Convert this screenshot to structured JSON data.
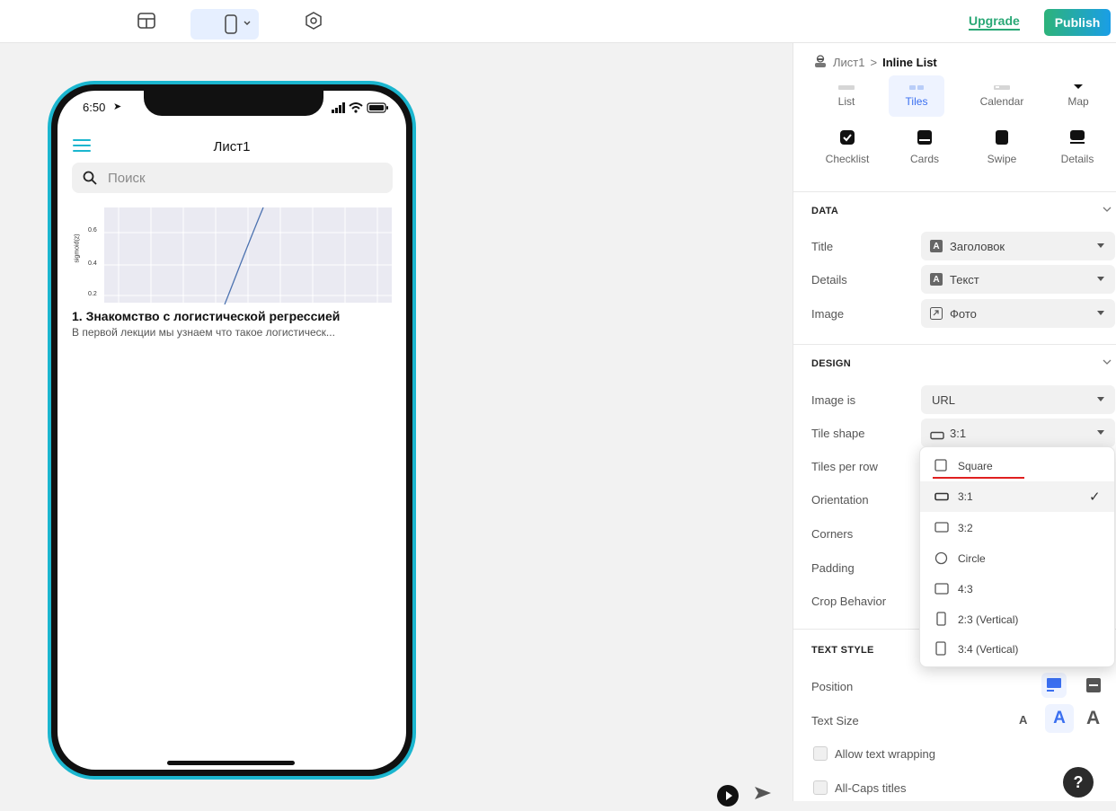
{
  "topbar": {
    "upgrade_label": "Upgrade",
    "publish_label": "Publish"
  },
  "phone": {
    "status_time": "6:50",
    "screen_title": "Лист1",
    "search_placeholder": "Поиск",
    "tile": {
      "title": "1. Знакомство с логистической регрессией",
      "description": "В первой лекции мы узнаем что такое логистическ...",
      "chart_ylabel": "sigmoid(z)",
      "chart_ticks": [
        "0.6",
        "0.4",
        "0.2"
      ]
    }
  },
  "panel": {
    "breadcrumb": {
      "root": "Лист1",
      "separator": ">",
      "current": "Inline List"
    },
    "styles_row1": [
      {
        "label": "List",
        "active": false
      },
      {
        "label": "Tiles",
        "active": true
      },
      {
        "label": "Calendar",
        "active": false
      },
      {
        "label": "Map",
        "active": false
      }
    ],
    "styles_row2": [
      {
        "label": "Checklist"
      },
      {
        "label": "Cards"
      },
      {
        "label": "Swipe"
      },
      {
        "label": "Details"
      }
    ],
    "data_section": {
      "header": "DATA",
      "rows": [
        {
          "label": "Title",
          "value": "Заголовок"
        },
        {
          "label": "Details",
          "value": "Текст"
        },
        {
          "label": "Image",
          "value": "Фото"
        }
      ]
    },
    "design_section": {
      "header": "DESIGN",
      "rows": [
        {
          "label": "Image is",
          "value": "URL"
        },
        {
          "label": "Tile shape",
          "value": "3:1"
        },
        {
          "label": "Tiles per row"
        },
        {
          "label": "Orientation"
        },
        {
          "label": "Corners"
        },
        {
          "label": "Padding"
        },
        {
          "label": "Crop Behavior"
        }
      ]
    },
    "text_style_section": {
      "header": "TEXT STYLE",
      "position_label": "Position",
      "text_size_label": "Text Size",
      "text_size_options": [
        "A",
        "A",
        "A"
      ],
      "allow_wrapping_label": "Allow text wrapping",
      "all_caps_label": "All-Caps titles"
    },
    "help_label": "?"
  },
  "dropdown": {
    "items": [
      {
        "label": "Square",
        "icon": "square-shape-icon"
      },
      {
        "label": "3:1",
        "icon": "wide-rect-icon",
        "selected": true
      },
      {
        "label": "3:2",
        "icon": "rect-icon"
      },
      {
        "label": "Circle",
        "icon": "circle-shape-icon"
      },
      {
        "label": "4:3",
        "icon": "rect-icon"
      },
      {
        "label": "2:3 (Vertical)",
        "icon": "vertical-rect-icon"
      },
      {
        "label": "3:4 (Vertical)",
        "icon": "vertical-rect-icon"
      }
    ]
  },
  "colors": {
    "accent_blue": "#3a6ff0",
    "upgrade_green": "#2aa876",
    "phone_border": "#1bb6cf",
    "annotation_red": "#e02020"
  }
}
